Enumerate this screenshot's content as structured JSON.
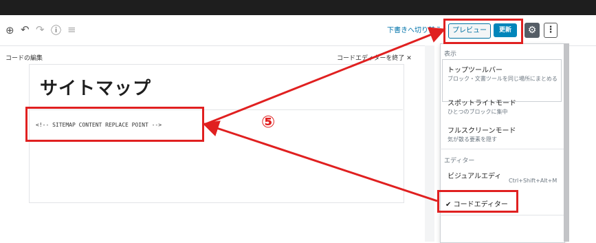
{
  "toolbar": {
    "draft_link": "下書きへ切り替え",
    "preview_label": "プレビュー",
    "update_label": "更新",
    "icons": [
      "add-block-icon",
      "undo-icon",
      "redo-icon",
      "info-icon",
      "list-view-icon",
      "gear-icon",
      "more-menu-icon"
    ]
  },
  "code_editor": {
    "heading": "コードの編集",
    "exit_label": "コードエディターを終了",
    "page_title": "サイトマップ",
    "content": "<!-- SITEMAP CONTENT REPLACE POINT -->"
  },
  "annotation": {
    "step": "⑤",
    "color": "#e02020"
  },
  "menu": {
    "view_heading": "表示",
    "items": [
      {
        "title": "トップツールバー",
        "desc": "ブロック・文書ツールを同じ場所にまとめる"
      },
      {
        "title": "スポットライトモード",
        "desc": "ひとつのブロックに集中"
      },
      {
        "title": "フルスクリーンモード",
        "desc": "気が散る要素を隠す"
      }
    ],
    "editor_heading": "エディター",
    "visual_editor": "ビジュアルエディター",
    "visual_shortcut": "Ctrl+Shift+Alt+M",
    "code_editor": "コードエディター"
  },
  "colors": {
    "accent": "#0085ba",
    "toolbar_dark": "#1e1e1e"
  }
}
